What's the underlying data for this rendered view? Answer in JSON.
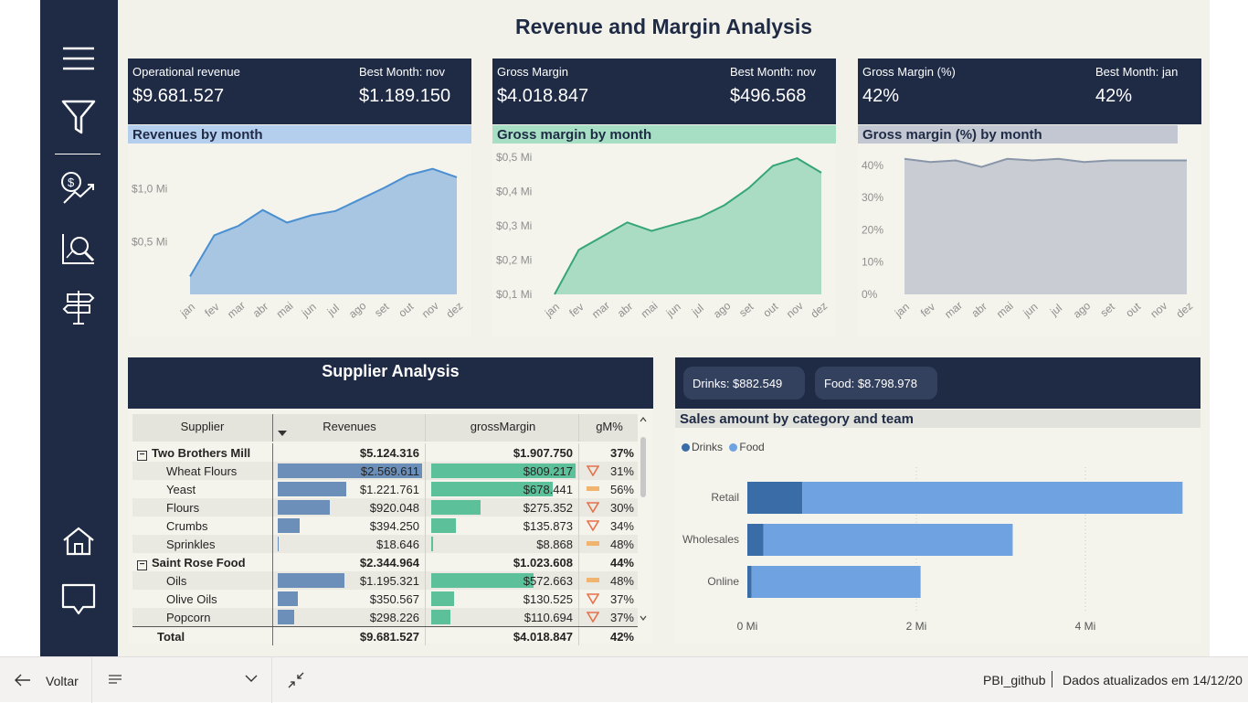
{
  "report": {
    "title": "Revenue and Margin Analysis"
  },
  "nav": {
    "items": [
      {
        "icon": "menu-icon"
      },
      {
        "icon": "filter-icon"
      },
      {
        "icon": "revenue-trend-icon"
      },
      {
        "icon": "analysis-search-icon"
      },
      {
        "icon": "signpost-icon"
      },
      {
        "icon": "home-icon"
      },
      {
        "icon": "comment-icon"
      }
    ]
  },
  "cards": [
    {
      "kpi_label": "Operational revenue",
      "kpi_value": "$9.681.527",
      "best_label": "Best Month: nov",
      "best_value": "$1.189.150",
      "chart_title": "Revenues by month",
      "title_bg": "#b4cfee"
    },
    {
      "kpi_label": "Gross Margin",
      "kpi_value": "$4.018.847",
      "best_label": "Best Month: nov",
      "best_value": "$496.568",
      "chart_title": "Gross margin by month",
      "title_bg": "#a6dfc4"
    },
    {
      "kpi_label": "Gross Margin (%)",
      "kpi_value": "42%",
      "best_label": "Best Month: jan",
      "best_value": "42%",
      "chart_title": "Gross margin (%) by month",
      "title_bg": "#c3c7d2"
    }
  ],
  "chart_data": [
    {
      "type": "area",
      "categories": [
        "jan",
        "fev",
        "mar",
        "abr",
        "mai",
        "jun",
        "jul",
        "ago",
        "set",
        "out",
        "nov",
        "dez"
      ],
      "values": [
        0.17,
        0.56,
        0.65,
        0.8,
        0.68,
        0.75,
        0.79,
        0.9,
        1.01,
        1.13,
        1.19,
        1.11
      ],
      "ylim": [
        0,
        1.3
      ],
      "yticks": [
        0.5,
        1.0
      ],
      "ytick_labels": [
        "$0,5 Mi",
        "$1,0 Mi"
      ],
      "color": "#4a8fd1",
      "fill": "#a8c6e2",
      "grid": false
    },
    {
      "type": "area",
      "categories": [
        "jan",
        "fev",
        "mar",
        "abr",
        "mai",
        "jun",
        "jul",
        "ago",
        "set",
        "out",
        "nov",
        "dez"
      ],
      "values": [
        0.1,
        0.23,
        0.27,
        0.31,
        0.285,
        0.305,
        0.325,
        0.36,
        0.41,
        0.475,
        0.497,
        0.455
      ],
      "ylim": [
        0.1,
        0.5
      ],
      "yticks": [
        0.1,
        0.2,
        0.3,
        0.4,
        0.5
      ],
      "ytick_labels": [
        "$0,1 Mi",
        "$0,2 Mi",
        "$0,3 Mi",
        "$0,4 Mi",
        "$0,5 Mi"
      ],
      "color": "#36a577",
      "fill": "#a9dcc3",
      "grid": false
    },
    {
      "type": "area",
      "categories": [
        "jan",
        "fev",
        "mar",
        "abr",
        "mai",
        "jun",
        "jul",
        "ago",
        "set",
        "out",
        "nov",
        "dez"
      ],
      "values": [
        42,
        41,
        41.5,
        39.5,
        42,
        41.5,
        42,
        41,
        41.5,
        41.5,
        41.5,
        41.5
      ],
      "ylim": [
        0,
        42.5
      ],
      "yticks": [
        0,
        10,
        20,
        30,
        40
      ],
      "ytick_labels": [
        "0%",
        "10%",
        "20%",
        "30%",
        "40%"
      ],
      "color": "#8996aa",
      "fill": "#c9ccd2",
      "grid": false
    },
    {
      "type": "bar",
      "title": "Sales amount by category and team",
      "categories": [
        "Retail",
        "Wholesales",
        "Online"
      ],
      "series": [
        {
          "name": "Drinks",
          "values": [
            0.65,
            0.19,
            0.05
          ],
          "color": "#3a6ca7"
        },
        {
          "name": "Food",
          "values": [
            4.5,
            2.95,
            2.0
          ],
          "color": "#6ea2e0"
        }
      ],
      "xlim": [
        0,
        5.2
      ],
      "xticks": [
        0,
        2,
        4
      ],
      "xtick_labels": [
        "0 Mi",
        "2 Mi",
        "4 Mi"
      ],
      "legend": "top-left",
      "grid": true
    }
  ],
  "supplier": {
    "title": "Supplier Analysis",
    "columns": [
      "Supplier",
      "Revenues",
      "grossMargin",
      "gM%"
    ],
    "rows": [
      {
        "kind": "group",
        "name": "Two Brothers Mill",
        "rev": "$5.124.316",
        "gm": "$1.907.750",
        "pct": "37%"
      },
      {
        "kind": "item",
        "name": "Wheat Flours",
        "rev": "$2.569.611",
        "gm": "$809.217",
        "pct": "31%",
        "rev_frac": 1.0,
        "gm_frac": 1.0,
        "ind": "down"
      },
      {
        "kind": "item",
        "name": "Yeast",
        "rev": "$1.221.761",
        "gm": "$678.441",
        "pct": "56%",
        "rev_frac": 0.475,
        "gm_frac": 0.84,
        "ind": "flat"
      },
      {
        "kind": "item",
        "name": "Flours",
        "rev": "$920.048",
        "gm": "$275.352",
        "pct": "30%",
        "rev_frac": 0.36,
        "gm_frac": 0.34,
        "ind": "down"
      },
      {
        "kind": "item",
        "name": "Crumbs",
        "rev": "$394.250",
        "gm": "$135.873",
        "pct": "34%",
        "rev_frac": 0.155,
        "gm_frac": 0.17,
        "ind": "down"
      },
      {
        "kind": "item",
        "name": "Sprinkles",
        "rev": "$18.646",
        "gm": "$8.868",
        "pct": "48%",
        "rev_frac": 0.008,
        "gm_frac": 0.011,
        "ind": "flat"
      },
      {
        "kind": "group",
        "name": "Saint Rose Food",
        "rev": "$2.344.964",
        "gm": "$1.023.608",
        "pct": "44%"
      },
      {
        "kind": "item",
        "name": "Oils",
        "rev": "$1.195.321",
        "gm": "$572.663",
        "pct": "48%",
        "rev_frac": 0.465,
        "gm_frac": 0.71,
        "ind": "flat"
      },
      {
        "kind": "item",
        "name": "Olive Oils",
        "rev": "$350.567",
        "gm": "$130.525",
        "pct": "37%",
        "rev_frac": 0.14,
        "gm_frac": 0.16,
        "ind": "down"
      },
      {
        "kind": "item",
        "name": "Popcorn",
        "rev": "$298.226",
        "gm": "$110.694",
        "pct": "37%",
        "rev_frac": 0.115,
        "gm_frac": 0.135,
        "ind": "down"
      },
      {
        "kind": "total",
        "name": "Total",
        "rev": "$9.681.527",
        "gm": "$4.018.847",
        "pct": "42%"
      }
    ]
  },
  "sales": {
    "pill_drinks": "Drinks: $882.549",
    "pill_food": "Food: $8.798.978",
    "title": "Sales amount by category and team",
    "legend_drinks": "Drinks",
    "legend_food": "Food"
  },
  "footer": {
    "back_label": "Voltar",
    "workspace": "PBI_github",
    "updated": "Dados atualizados em 14/12/20"
  },
  "colors": {
    "navy": "#1f2b45",
    "canvas": "#f2f2ea",
    "down": "#e8704a",
    "flat": "#f0b46e"
  }
}
